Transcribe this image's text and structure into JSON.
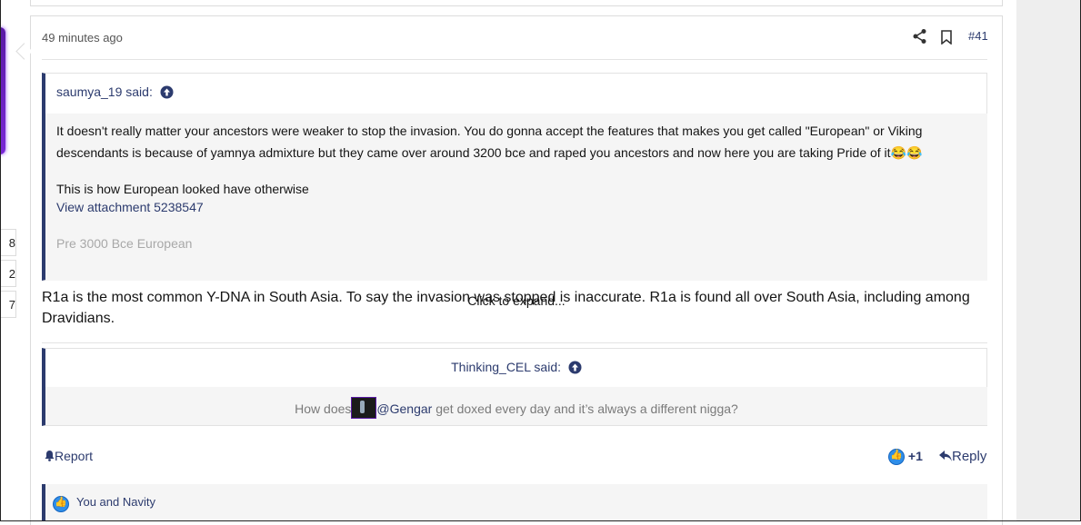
{
  "left_stats": [
    "8",
    "2",
    "7"
  ],
  "post": {
    "timestamp": "49 minutes ago",
    "post_number": "#41",
    "icons": {
      "share": "share-icon",
      "bookmark": "bookmark-icon"
    },
    "quote1": {
      "author_said": "saumya_19 said:",
      "line1": "It doesn't really matter your ancestors were weaker to stop the invasion. You do gonna accept the features that makes you get called \"European\" or Viking",
      "line2": "descendants is because of yamnya admixture but they came over around 3200 bce and raped you ancestors and now here you are taking Pride of it",
      "emoji": "😂😂",
      "line3": "This is how European looked have otherwise",
      "attachment": "View attachment 5238547",
      "line4": "Pre 3000 Bce European",
      "expand": "Click to expand..."
    },
    "body": "R1a is the most common Y-DNA in South Asia. To say the invasion was stopped is inaccurate. R1a is found all over South Asia, including among Dravidians.",
    "quote2": {
      "author_said": "Thinking_CEL said:",
      "text_before": "How does",
      "mention": "@Gengar",
      "text_after": " get doxed every day and it’s always a different nigga?"
    },
    "actions": {
      "report": "Report",
      "score": "+1",
      "reply": "Reply"
    },
    "reactions_text": "You and Navity"
  },
  "colors": {
    "link": "#2c3b6e",
    "quote_bar": "#2c3b6e",
    "avatar_glow": "#7a28d6"
  }
}
